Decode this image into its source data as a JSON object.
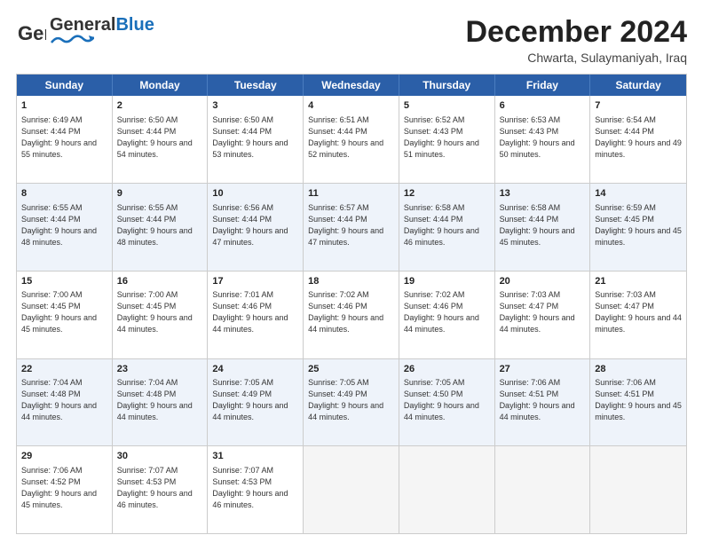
{
  "header": {
    "logo_general": "General",
    "logo_blue": "Blue",
    "month_title": "December 2024",
    "subtitle": "Chwarta, Sulaymaniyah, Iraq"
  },
  "days": [
    "Sunday",
    "Monday",
    "Tuesday",
    "Wednesday",
    "Thursday",
    "Friday",
    "Saturday"
  ],
  "rows": [
    [
      {
        "day": "1",
        "sunrise": "Sunrise: 6:49 AM",
        "sunset": "Sunset: 4:44 PM",
        "daylight": "Daylight: 9 hours and 55 minutes."
      },
      {
        "day": "2",
        "sunrise": "Sunrise: 6:50 AM",
        "sunset": "Sunset: 4:44 PM",
        "daylight": "Daylight: 9 hours and 54 minutes."
      },
      {
        "day": "3",
        "sunrise": "Sunrise: 6:50 AM",
        "sunset": "Sunset: 4:44 PM",
        "daylight": "Daylight: 9 hours and 53 minutes."
      },
      {
        "day": "4",
        "sunrise": "Sunrise: 6:51 AM",
        "sunset": "Sunset: 4:44 PM",
        "daylight": "Daylight: 9 hours and 52 minutes."
      },
      {
        "day": "5",
        "sunrise": "Sunrise: 6:52 AM",
        "sunset": "Sunset: 4:43 PM",
        "daylight": "Daylight: 9 hours and 51 minutes."
      },
      {
        "day": "6",
        "sunrise": "Sunrise: 6:53 AM",
        "sunset": "Sunset: 4:43 PM",
        "daylight": "Daylight: 9 hours and 50 minutes."
      },
      {
        "day": "7",
        "sunrise": "Sunrise: 6:54 AM",
        "sunset": "Sunset: 4:44 PM",
        "daylight": "Daylight: 9 hours and 49 minutes."
      }
    ],
    [
      {
        "day": "8",
        "sunrise": "Sunrise: 6:55 AM",
        "sunset": "Sunset: 4:44 PM",
        "daylight": "Daylight: 9 hours and 48 minutes."
      },
      {
        "day": "9",
        "sunrise": "Sunrise: 6:55 AM",
        "sunset": "Sunset: 4:44 PM",
        "daylight": "Daylight: 9 hours and 48 minutes."
      },
      {
        "day": "10",
        "sunrise": "Sunrise: 6:56 AM",
        "sunset": "Sunset: 4:44 PM",
        "daylight": "Daylight: 9 hours and 47 minutes."
      },
      {
        "day": "11",
        "sunrise": "Sunrise: 6:57 AM",
        "sunset": "Sunset: 4:44 PM",
        "daylight": "Daylight: 9 hours and 47 minutes."
      },
      {
        "day": "12",
        "sunrise": "Sunrise: 6:58 AM",
        "sunset": "Sunset: 4:44 PM",
        "daylight": "Daylight: 9 hours and 46 minutes."
      },
      {
        "day": "13",
        "sunrise": "Sunrise: 6:58 AM",
        "sunset": "Sunset: 4:44 PM",
        "daylight": "Daylight: 9 hours and 45 minutes."
      },
      {
        "day": "14",
        "sunrise": "Sunrise: 6:59 AM",
        "sunset": "Sunset: 4:45 PM",
        "daylight": "Daylight: 9 hours and 45 minutes."
      }
    ],
    [
      {
        "day": "15",
        "sunrise": "Sunrise: 7:00 AM",
        "sunset": "Sunset: 4:45 PM",
        "daylight": "Daylight: 9 hours and 45 minutes."
      },
      {
        "day": "16",
        "sunrise": "Sunrise: 7:00 AM",
        "sunset": "Sunset: 4:45 PM",
        "daylight": "Daylight: 9 hours and 44 minutes."
      },
      {
        "day": "17",
        "sunrise": "Sunrise: 7:01 AM",
        "sunset": "Sunset: 4:46 PM",
        "daylight": "Daylight: 9 hours and 44 minutes."
      },
      {
        "day": "18",
        "sunrise": "Sunrise: 7:02 AM",
        "sunset": "Sunset: 4:46 PM",
        "daylight": "Daylight: 9 hours and 44 minutes."
      },
      {
        "day": "19",
        "sunrise": "Sunrise: 7:02 AM",
        "sunset": "Sunset: 4:46 PM",
        "daylight": "Daylight: 9 hours and 44 minutes."
      },
      {
        "day": "20",
        "sunrise": "Sunrise: 7:03 AM",
        "sunset": "Sunset: 4:47 PM",
        "daylight": "Daylight: 9 hours and 44 minutes."
      },
      {
        "day": "21",
        "sunrise": "Sunrise: 7:03 AM",
        "sunset": "Sunset: 4:47 PM",
        "daylight": "Daylight: 9 hours and 44 minutes."
      }
    ],
    [
      {
        "day": "22",
        "sunrise": "Sunrise: 7:04 AM",
        "sunset": "Sunset: 4:48 PM",
        "daylight": "Daylight: 9 hours and 44 minutes."
      },
      {
        "day": "23",
        "sunrise": "Sunrise: 7:04 AM",
        "sunset": "Sunset: 4:48 PM",
        "daylight": "Daylight: 9 hours and 44 minutes."
      },
      {
        "day": "24",
        "sunrise": "Sunrise: 7:05 AM",
        "sunset": "Sunset: 4:49 PM",
        "daylight": "Daylight: 9 hours and 44 minutes."
      },
      {
        "day": "25",
        "sunrise": "Sunrise: 7:05 AM",
        "sunset": "Sunset: 4:49 PM",
        "daylight": "Daylight: 9 hours and 44 minutes."
      },
      {
        "day": "26",
        "sunrise": "Sunrise: 7:05 AM",
        "sunset": "Sunset: 4:50 PM",
        "daylight": "Daylight: 9 hours and 44 minutes."
      },
      {
        "day": "27",
        "sunrise": "Sunrise: 7:06 AM",
        "sunset": "Sunset: 4:51 PM",
        "daylight": "Daylight: 9 hours and 44 minutes."
      },
      {
        "day": "28",
        "sunrise": "Sunrise: 7:06 AM",
        "sunset": "Sunset: 4:51 PM",
        "daylight": "Daylight: 9 hours and 45 minutes."
      }
    ],
    [
      {
        "day": "29",
        "sunrise": "Sunrise: 7:06 AM",
        "sunset": "Sunset: 4:52 PM",
        "daylight": "Daylight: 9 hours and 45 minutes."
      },
      {
        "day": "30",
        "sunrise": "Sunrise: 7:07 AM",
        "sunset": "Sunset: 4:53 PM",
        "daylight": "Daylight: 9 hours and 46 minutes."
      },
      {
        "day": "31",
        "sunrise": "Sunrise: 7:07 AM",
        "sunset": "Sunset: 4:53 PM",
        "daylight": "Daylight: 9 hours and 46 minutes."
      },
      null,
      null,
      null,
      null
    ]
  ]
}
